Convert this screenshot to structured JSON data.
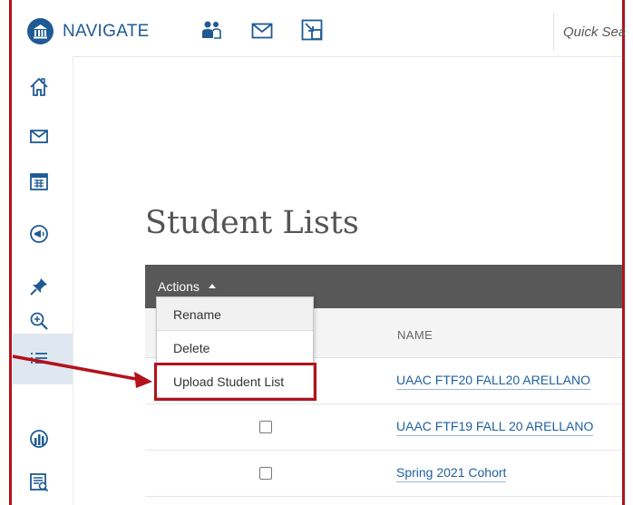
{
  "app": {
    "brand": "NAVIGATE",
    "quick_search_placeholder": "Quick Sea"
  },
  "page": {
    "title": "Student Lists"
  },
  "toolbar": {
    "actions_label": "Actions"
  },
  "actions_menu": {
    "items": [
      "Rename",
      "Delete",
      "Upload Student List"
    ]
  },
  "table": {
    "columns": [
      "NAME"
    ],
    "rows": [
      {
        "name": "UAAC FTF20 FALL20 ARELLANO"
      },
      {
        "name": "UAAC FTF19 FALL 20 ARELLANO"
      },
      {
        "name": "Spring 2021 Cohort"
      }
    ]
  },
  "colors": {
    "brand_blue": "#1f5a94",
    "callout_red": "#b3121b",
    "actions_bar": "#585858",
    "link_blue": "#1e5f9e"
  },
  "sidebar": {
    "items": [
      "home-icon",
      "mail-icon",
      "calendar-icon",
      "campaign-icon",
      "pin-icon",
      "search-zoom-icon",
      "list-icon",
      "reports-icon",
      "appointment-report-icon"
    ],
    "active": "list-icon"
  }
}
